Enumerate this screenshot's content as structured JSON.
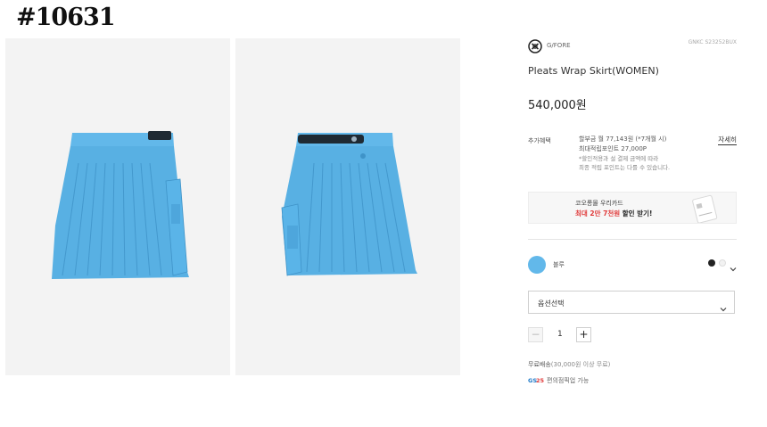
{
  "tag": "#10631",
  "brand": {
    "name": "G/FORE"
  },
  "product": {
    "sku": "GNKC S23252BUX",
    "title": "Pleats Wrap Skirt(WOMEN)",
    "price": "540,000원"
  },
  "benefits": {
    "label": "추가혜택",
    "installment": "할부금 월 77,143원 (*7개월 시)",
    "points": "최대적립포인트 27,000P",
    "note_line1": "*할인적용과 설 결제 금액에 따라",
    "note_line2": "최종 적립 포인트는 다를 수 있습니다.",
    "link": "자세히"
  },
  "banner": {
    "line1": "코오롱몰 우리카드",
    "line2_red": "최대 2만 7천원",
    "line2_rest": " 할인 받기!"
  },
  "color": {
    "selected_label": "블루",
    "swatch_hex": "#62b8ea"
  },
  "option_select": {
    "value": "옵션선택"
  },
  "quantity": {
    "value": "1",
    "minus": "−",
    "plus": "+"
  },
  "shipping": {
    "text": "무료배송",
    "condition": "(30,000원 이상 무료)"
  },
  "pickup": {
    "text": "편의점픽업 가능"
  },
  "icons": {
    "brand_logo": "gfore-logo-icon",
    "card": "credit-card-icon",
    "dropdown": "chevron-down-icon",
    "gs25": "gs25-logo-icon"
  },
  "colors": {
    "skirt": "#5bb3e6",
    "panel": "#f3f3f3",
    "sale_red": "#e03a3a"
  }
}
